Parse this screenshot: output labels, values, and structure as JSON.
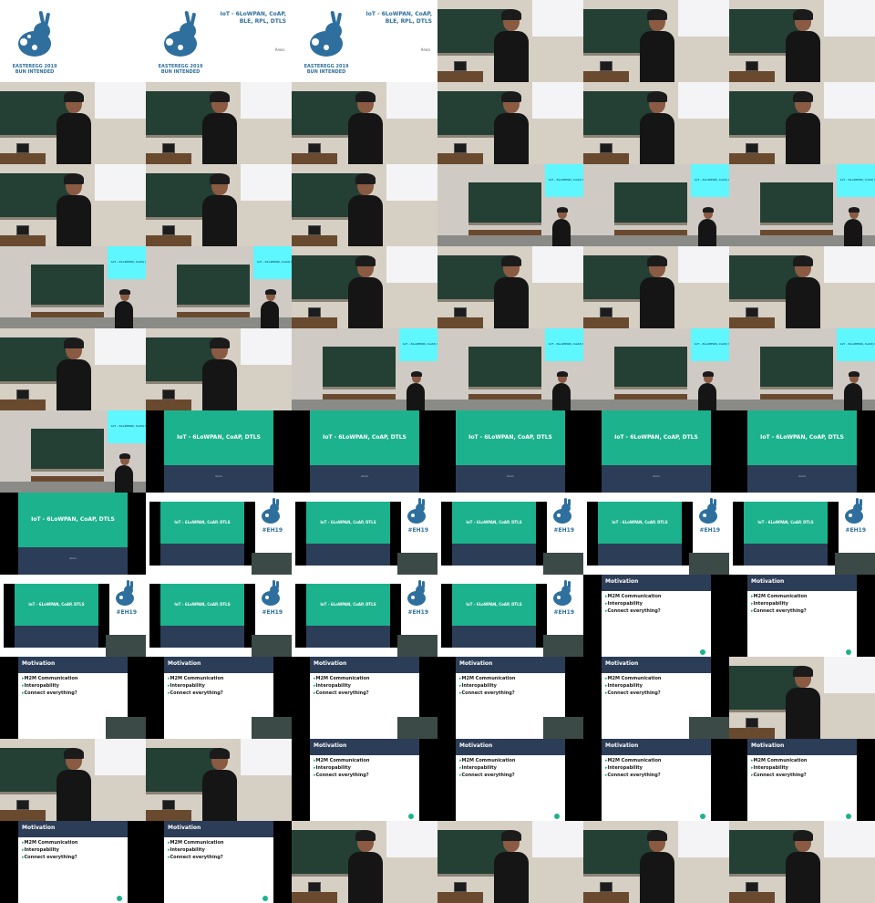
{
  "logo": {
    "event_line1": "EASTEREGG 2019",
    "event_line2": "BUN INTENDED",
    "hashtag": "#EH19"
  },
  "talk": {
    "title_full": "IoT - 6LoWPAN, CoAP, BLE, RPL, DTLS",
    "title_short": "IoT - 6LoWPAN, CoAP, DTLS",
    "speaker": "Anon"
  },
  "slide_motivation": {
    "heading": "Motivation",
    "bullets": [
      "M2M Communication",
      "Interopability",
      "Connect everything?"
    ]
  },
  "tiles": [
    "logo",
    "logo-title",
    "logo-title",
    "speaker",
    "speaker",
    "speaker",
    "speaker",
    "speaker",
    "speaker",
    "speaker",
    "speaker",
    "speaker",
    "speaker",
    "speaker",
    "speaker",
    "wide",
    "wide",
    "wide",
    "wide",
    "wide",
    "speaker",
    "speaker",
    "speaker",
    "speaker",
    "speaker",
    "speaker",
    "wide",
    "wide",
    "wide",
    "wide",
    "wide",
    "teal",
    "teal",
    "teal",
    "teal",
    "teal",
    "teal",
    "hybrid",
    "hybrid",
    "hybrid",
    "hybrid",
    "hybrid",
    "hybrid",
    "hybrid",
    "hybrid",
    "hybrid",
    "mot",
    "mot",
    "mot-inset",
    "mot-inset",
    "mot-inset",
    "mot-inset",
    "mot-inset",
    "speaker",
    "speaker",
    "speaker",
    "mot",
    "mot",
    "mot",
    "mot",
    "mot",
    "mot",
    "speaker",
    "speaker",
    "speaker",
    "speaker"
  ],
  "colors": {
    "teal": "#1cb28d",
    "navy": "#2c3d57",
    "cyan_projection": "#5ef6ff",
    "logo_blue": "#2e6f9e"
  }
}
